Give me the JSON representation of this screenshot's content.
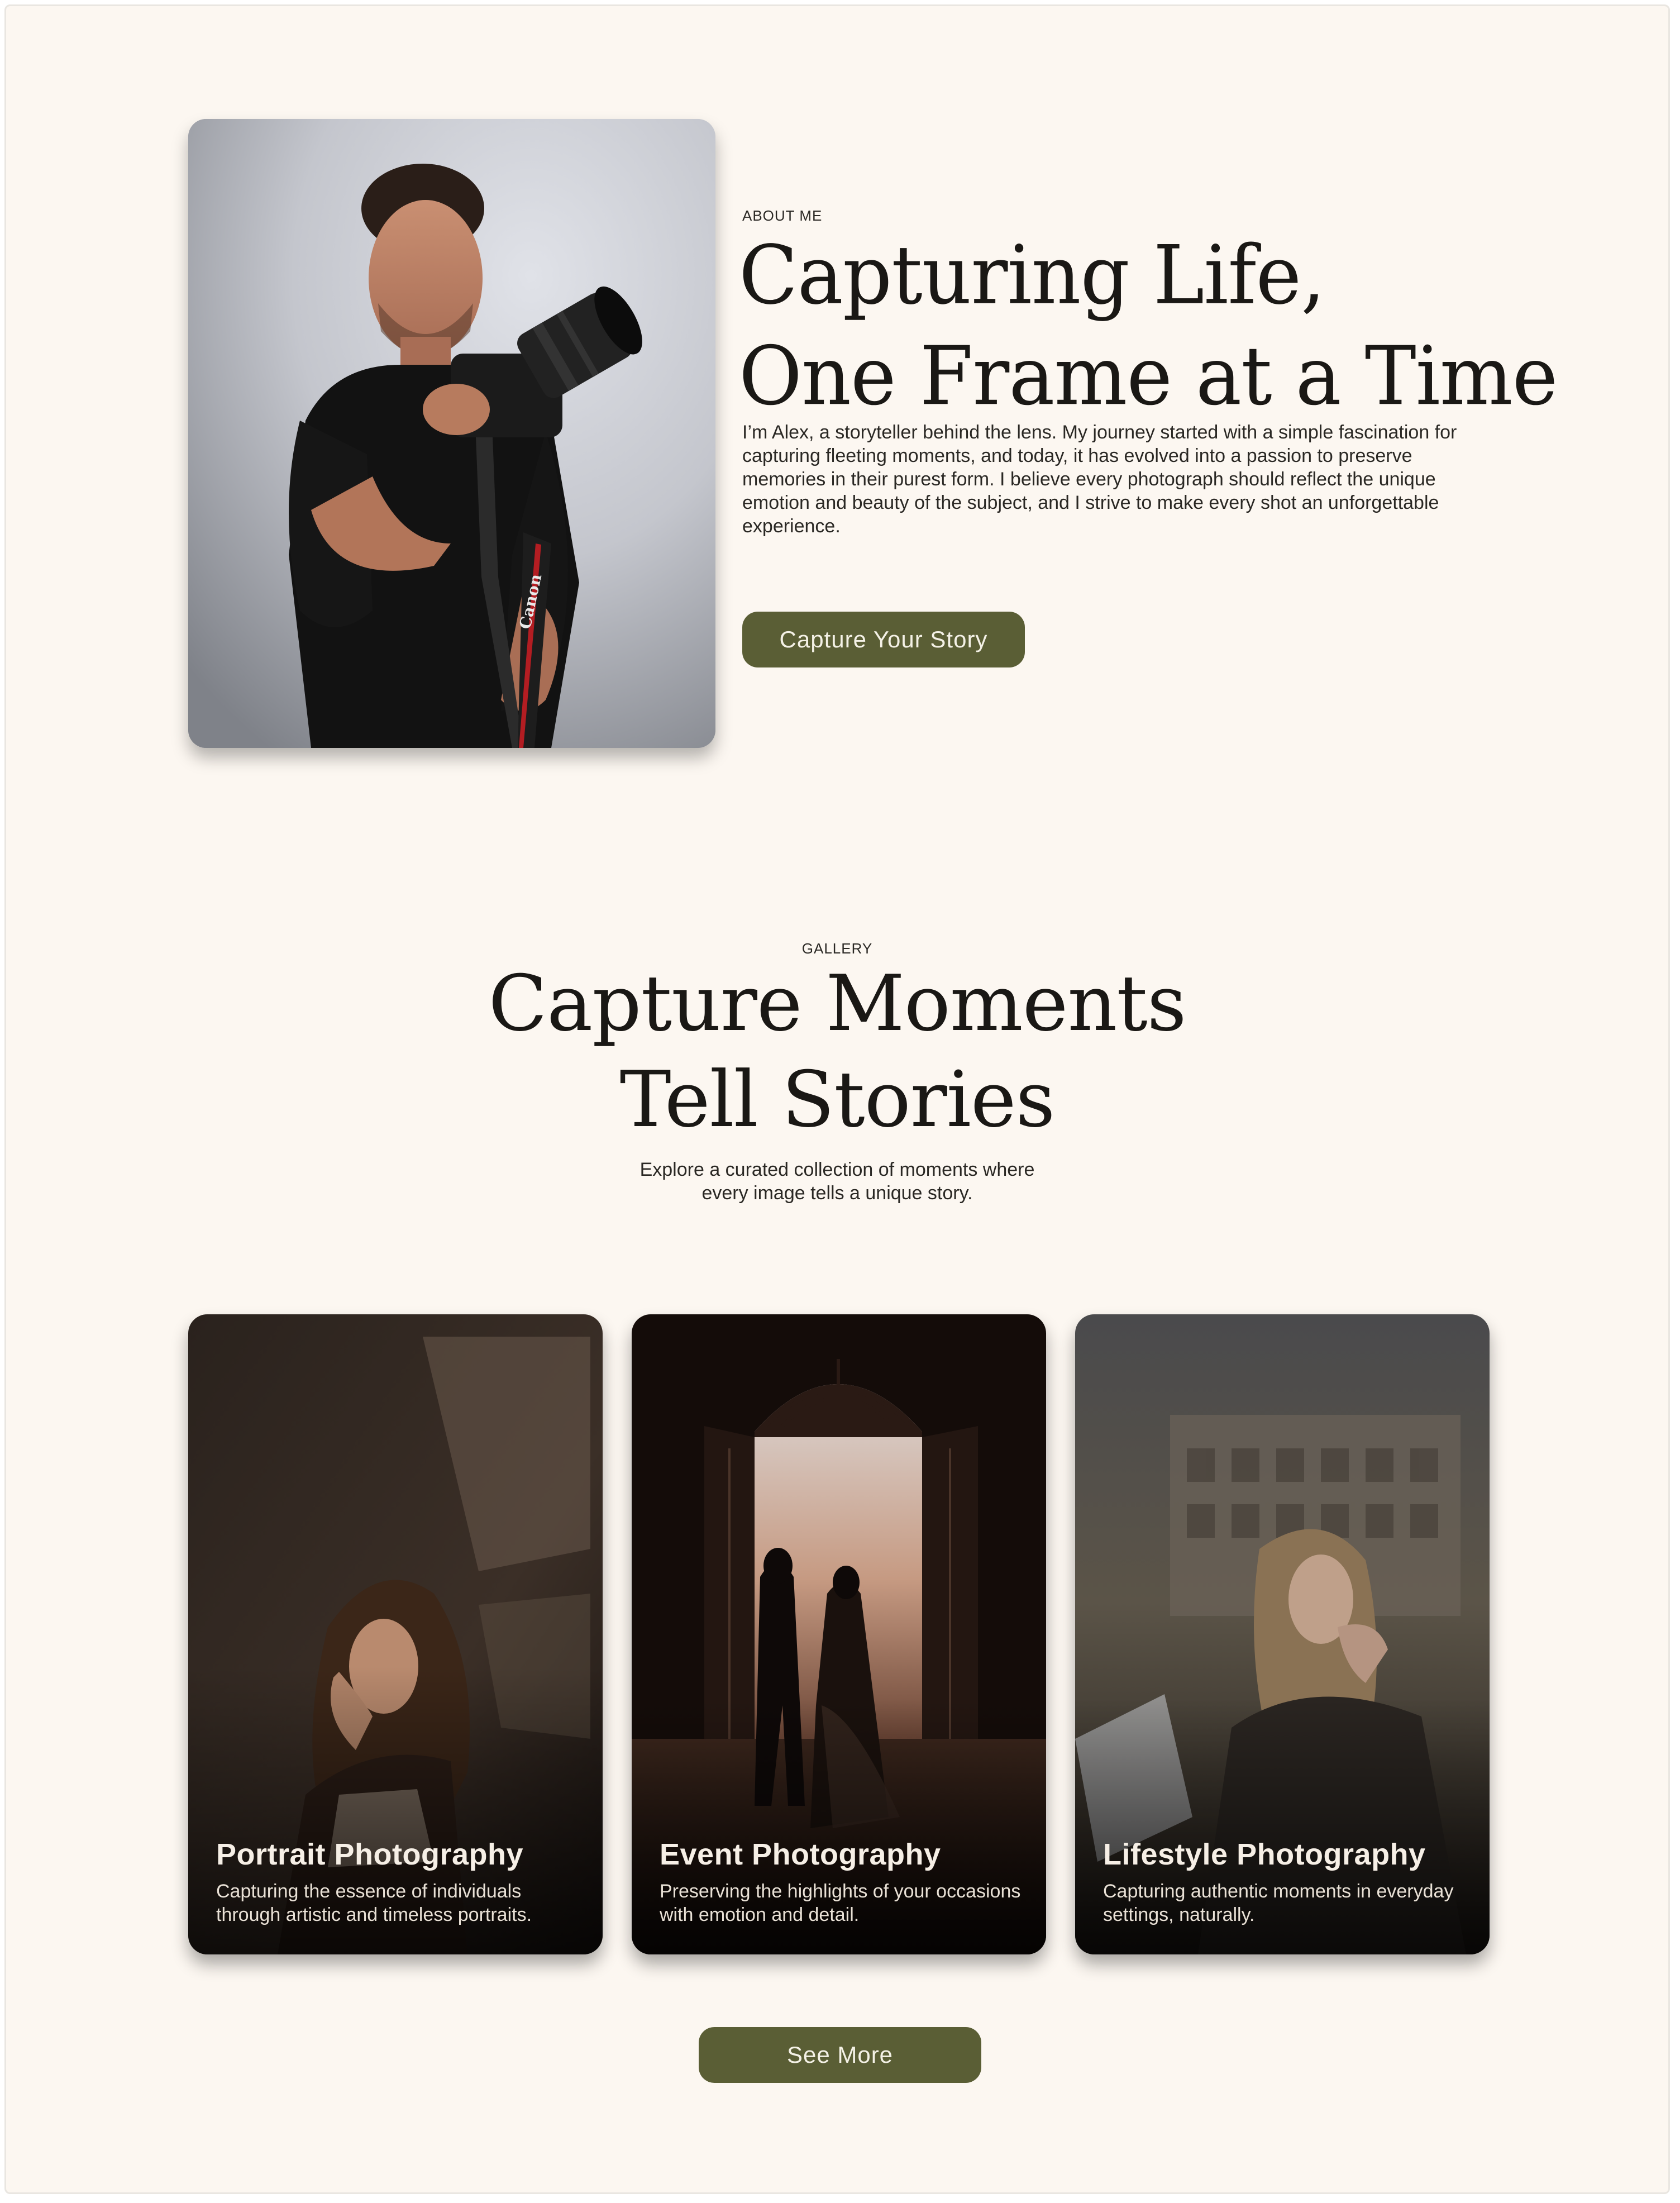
{
  "about": {
    "eyebrow": "ABOUT ME",
    "title_line1": "Capturing Life,",
    "title_line2": "One Frame at a Time",
    "body": "I’m Alex, a storyteller behind the lens. My journey started with a simple fascination for capturing fleeting moments, and today, it has evolved into a passion to preserve memories in their purest form. I believe every photograph should reflect the unique emotion and beauty of the subject, and I strive to make every shot an unforgettable experience.",
    "button_label": "Capture Your Story",
    "camera_brand": "Canon"
  },
  "gallery": {
    "eyebrow": "GALLERY",
    "title_line1": "Capture Moments",
    "title_line2": "Tell Stories",
    "subtitle_line1": "Explore a curated collection of moments where",
    "subtitle_line2": "every image tells a unique story.",
    "cards": [
      {
        "title": "Portrait Photography",
        "description": "Capturing the essence of individuals through artistic and timeless portraits."
      },
      {
        "title": "Event Photography",
        "description": "Preserving the highlights of your occasions with emotion and detail."
      },
      {
        "title": "Lifestyle Photography",
        "description": "Capturing authentic moments in everyday settings, naturally."
      }
    ],
    "button_label": "See More"
  },
  "colors": {
    "background": "#fcf7f1",
    "accent": "#5a5e35",
    "text": "#1a1815"
  }
}
